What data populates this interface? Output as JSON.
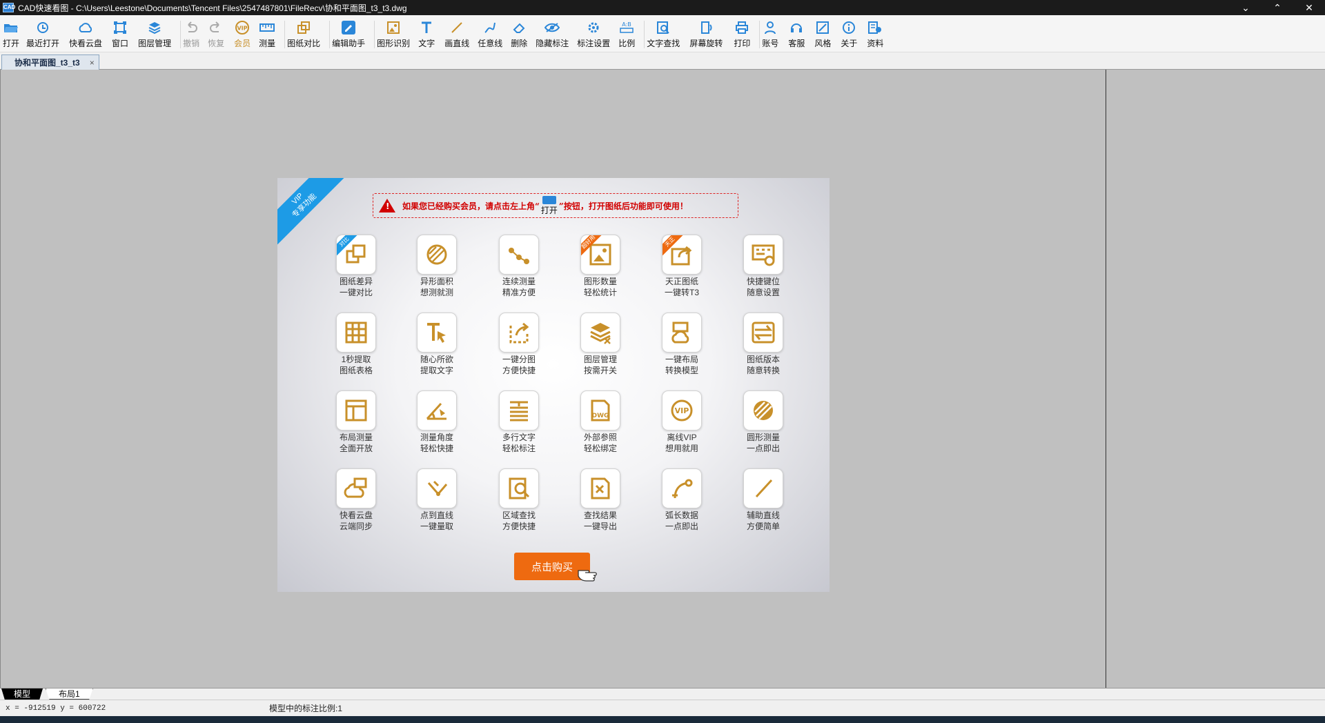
{
  "window": {
    "title": "CAD快速看图 - C:\\Users\\Leestone\\Documents\\Tencent Files\\2547487801\\FileRecv\\协和平面图_t3_t3.dwg",
    "app_icon_text": "CAD"
  },
  "toolbar": {
    "items": [
      {
        "label": "打开",
        "icon": "folder-open-icon"
      },
      {
        "label": "最近打开",
        "icon": "recent-icon"
      },
      {
        "label": "快看云盘",
        "icon": "cloud-icon"
      },
      {
        "label": "窗口",
        "icon": "window-icon"
      },
      {
        "label": "图层管理",
        "icon": "layers-icon"
      },
      {
        "label": "撤销",
        "icon": "undo-icon"
      },
      {
        "label": "恢复",
        "icon": "redo-icon"
      },
      {
        "label": "会员",
        "icon": "vip-icon"
      },
      {
        "label": "测量",
        "icon": "measure-icon"
      },
      {
        "label": "图纸对比",
        "icon": "compare-icon"
      },
      {
        "label": "编辑助手",
        "icon": "edit-helper-icon"
      },
      {
        "label": "图形识别",
        "icon": "shape-recognize-icon"
      },
      {
        "label": "文字",
        "icon": "text-icon"
      },
      {
        "label": "画直线",
        "icon": "line-icon"
      },
      {
        "label": "任意线",
        "icon": "freehand-icon"
      },
      {
        "label": "删除",
        "icon": "eraser-icon"
      },
      {
        "label": "隐藏标注",
        "icon": "hide-annotation-icon"
      },
      {
        "label": "标注设置",
        "icon": "annotation-settings-icon"
      },
      {
        "label": "比例",
        "icon": "scale-icon"
      },
      {
        "label": "文字查找",
        "icon": "text-search-icon"
      },
      {
        "label": "屏幕旋转",
        "icon": "rotate-screen-icon"
      },
      {
        "label": "打印",
        "icon": "print-icon"
      },
      {
        "label": "账号",
        "icon": "account-icon"
      },
      {
        "label": "客服",
        "icon": "headset-icon"
      },
      {
        "label": "风格",
        "icon": "style-icon"
      },
      {
        "label": "关于",
        "icon": "info-icon"
      },
      {
        "label": "资料",
        "icon": "documents-icon"
      }
    ]
  },
  "document_tab": {
    "label": "协和平面图_t3_t3",
    "close": "×"
  },
  "vip_panel": {
    "ribbon_line1": "VIP",
    "ribbon_line2": "专享功能",
    "notice_before": "如果您已经购买会员，请点击左上角“",
    "notice_open_label": "打开",
    "notice_after": "”按钮，打开图纸后功能即可使用！",
    "buy_button": "点击购买",
    "features": [
      {
        "l1": "图纸差异",
        "l2": "一键对比",
        "icon": "compare-drawings-icon",
        "badge": "对比"
      },
      {
        "l1": "异形面积",
        "l2": "想测就测",
        "icon": "irregular-area-icon"
      },
      {
        "l1": "连续测量",
        "l2": "精准方便",
        "icon": "continuous-measure-icon"
      },
      {
        "l1": "图形数量",
        "l2": "轻松统计",
        "icon": "shape-count-icon",
        "badge": "超好用"
      },
      {
        "l1": "天正图纸",
        "l2": "一键转T3",
        "icon": "tangent-convert-icon",
        "badge": "天正"
      },
      {
        "l1": "快捷键位",
        "l2": "随意设置",
        "icon": "hotkey-icon"
      },
      {
        "l1": "1秒提取",
        "l2": "图纸表格",
        "icon": "table-extract-icon"
      },
      {
        "l1": "随心所欲",
        "l2": "提取文字",
        "icon": "text-extract-icon"
      },
      {
        "l1": "一键分图",
        "l2": "方便快捷",
        "icon": "split-drawing-icon"
      },
      {
        "l1": "图层管理",
        "l2": "按需开关",
        "icon": "layer-toggle-icon"
      },
      {
        "l1": "一键布局",
        "l2": "转换模型",
        "icon": "layout-convert-icon"
      },
      {
        "l1": "图纸版本",
        "l2": "随意转换",
        "icon": "version-convert-icon"
      },
      {
        "l1": "布局测量",
        "l2": "全面开放",
        "icon": "layout-measure-icon"
      },
      {
        "l1": "测量角度",
        "l2": "轻松快捷",
        "icon": "angle-measure-icon"
      },
      {
        "l1": "多行文字",
        "l2": "轻松标注",
        "icon": "multiline-text-icon"
      },
      {
        "l1": "外部参照",
        "l2": "轻松绑定",
        "icon": "xref-dwg-icon"
      },
      {
        "l1": "离线VIP",
        "l2": "想用就用",
        "icon": "offline-vip-icon"
      },
      {
        "l1": "圆形测量",
        "l2": "一点即出",
        "icon": "circle-measure-icon"
      },
      {
        "l1": "快看云盘",
        "l2": "云端同步",
        "icon": "cloud-sync-icon"
      },
      {
        "l1": "点到直线",
        "l2": "一键量取",
        "icon": "point-to-line-icon"
      },
      {
        "l1": "区域查找",
        "l2": "方便快捷",
        "icon": "area-search-icon"
      },
      {
        "l1": "查找结果",
        "l2": "一键导出",
        "icon": "export-results-icon"
      },
      {
        "l1": "弧长数据",
        "l2": "一点即出",
        "icon": "arc-length-icon"
      },
      {
        "l1": "辅助直线",
        "l2": "方便简单",
        "icon": "assist-line-icon"
      }
    ]
  },
  "layout_tabs": {
    "model": "模型",
    "layout1": "布局1"
  },
  "status": {
    "coords": "x = -912519  y = 600722",
    "scale_text": "模型中的标注比例:1"
  },
  "colors": {
    "gold": "#c8902a",
    "accent_blue": "#1d9be6",
    "buy_orange": "#ee6a10",
    "notice_red": "#d10000"
  }
}
